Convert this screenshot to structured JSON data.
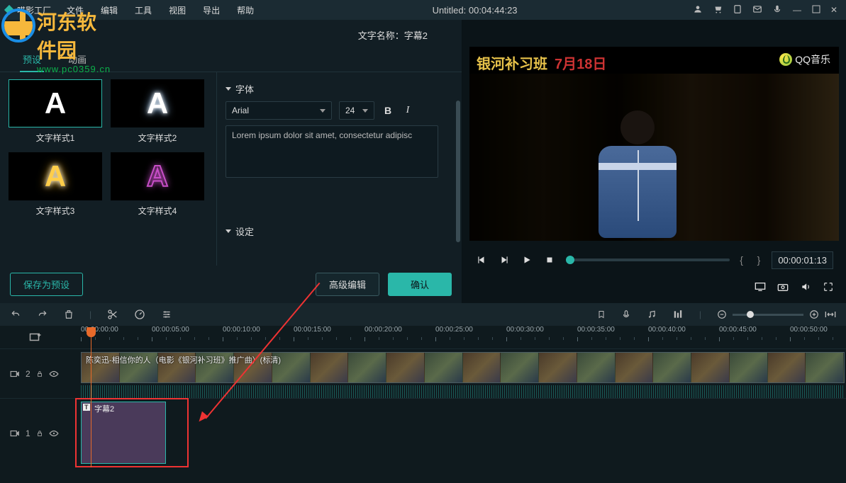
{
  "titlebar": {
    "app_name": "喵影工厂",
    "menu": [
      "文件",
      "编辑",
      "工具",
      "视图",
      "导出",
      "帮助"
    ],
    "title": "Untitled: 00:04:44:23"
  },
  "left": {
    "tabs": {
      "preset": "预设",
      "anim": "动画"
    },
    "text_name_label": "文字名称：",
    "text_name_value": "字幕2",
    "styles": [
      {
        "label": "文字样式1"
      },
      {
        "label": "文字样式2"
      },
      {
        "label": "文字样式3"
      },
      {
        "label": "文字样式4"
      }
    ],
    "font_section": "字体",
    "font_family": "Arial",
    "font_size": "24",
    "text_content": "Lorem ipsum dolor sit amet, consectetur adipisc",
    "settings_section": "设定",
    "save_preset": "保存为预设",
    "advanced": "高级编辑",
    "confirm": "确认"
  },
  "preview": {
    "title_yellow": "银河补习班",
    "title_red": "7月18日",
    "qq": "QQ音乐",
    "timecode": "00:00:01:13"
  },
  "timeline": {
    "ticks": [
      "00:00:00:00",
      "00:00:05:00",
      "00:00:10:00",
      "00:00:15:00",
      "00:00:20:00",
      "00:00:25:00",
      "00:00:30:00",
      "00:00:35:00",
      "00:00:40:00",
      "00:00:45:00",
      "00:00:50:00"
    ],
    "track2_label": "2",
    "track1_label": "1",
    "clip_title": "陈奕迅-相信你的人（电影《银河补习班》推广曲）(标清)",
    "text_badge": "T",
    "text_clip_label": "字幕2"
  }
}
